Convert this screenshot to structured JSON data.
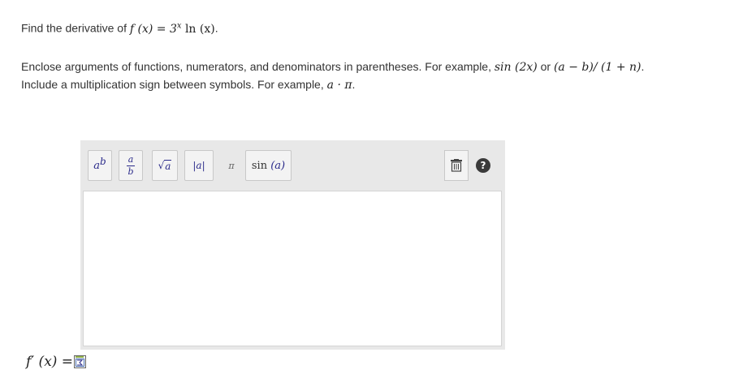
{
  "question": {
    "prefix": "Find the derivative of ",
    "function_math": "f (x) = 3",
    "exponent": "x",
    "function_tail": " ln (x)",
    "period": "."
  },
  "instructions": {
    "line1_text": "Enclose arguments of functions, numerators, and denominators in parentheses. For example, ",
    "line1_example1": "sin (2x)",
    "line1_or": " or ",
    "line1_example2": "(a − b)/ (1 + n)",
    "line1_end": ".",
    "line2_text": "Include a multiplication sign between symbols. For example, ",
    "line2_example": "a · π",
    "line2_end": "."
  },
  "toolbar": {
    "power_base": "a",
    "power_exp": "b",
    "frac_num": "a",
    "frac_den": "b",
    "sqrt_sym": "√",
    "sqrt_arg": "a",
    "abs_left": "|",
    "abs_arg": "a",
    "abs_right": "|",
    "pi": "π",
    "sin_fn": "sin",
    "sin_arg": "(a)",
    "help": "?"
  },
  "input": {
    "value": ""
  },
  "answer": {
    "label": "f′ (x) ="
  },
  "colors": {
    "toolbar_bg": "#e8e8e8",
    "button_text": "#2a2a8a",
    "help_bg": "#3a3a3a"
  }
}
